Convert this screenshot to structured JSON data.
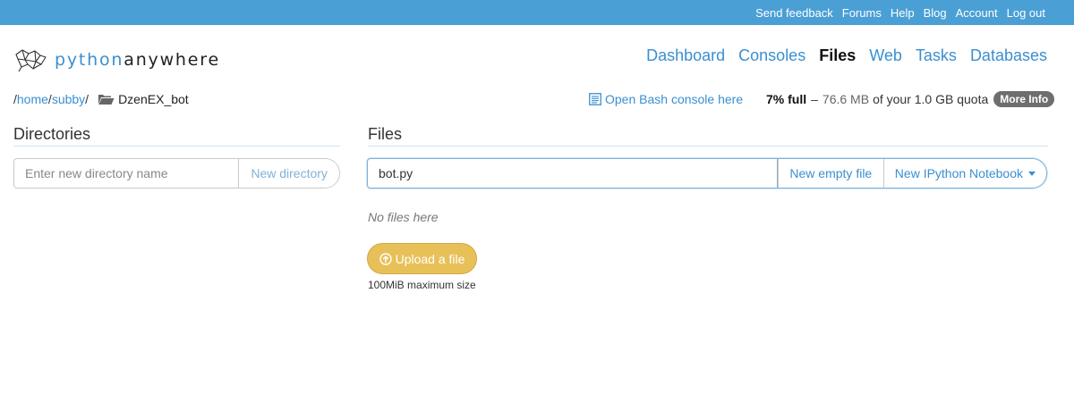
{
  "topbar": {
    "links": [
      "Send feedback",
      "Forums",
      "Help",
      "Blog",
      "Account",
      "Log out"
    ]
  },
  "logo": {
    "part1": "python",
    "part2": "anywhere",
    "icon": "python-snake-logo-icon"
  },
  "nav": {
    "items": [
      "Dashboard",
      "Consoles",
      "Files",
      "Web",
      "Tasks",
      "Databases"
    ],
    "active": "Files"
  },
  "breadcrumb": {
    "home": "home",
    "user": "subby",
    "sep": "/",
    "current": "DzenEX_bot",
    "icon": "folder-open-icon"
  },
  "bash": {
    "label": "Open Bash console here",
    "icon": "console-icon"
  },
  "quota": {
    "percent": "7% full",
    "dash": "–",
    "used": "76.6 MB",
    "rest": "of your 1.0 GB quota",
    "more": "More Info"
  },
  "directories": {
    "title": "Directories",
    "placeholder": "Enter new directory name",
    "button": "New directory"
  },
  "files": {
    "title": "Files",
    "value": "bot.py",
    "new_file": "New empty file",
    "notebook": "New IPython Notebook",
    "empty": "No files here",
    "upload": "Upload a file",
    "upload_icon": "upload-arrow-icon",
    "limit": "100MiB maximum size"
  },
  "colors": {
    "topbar": "#4a9fd5",
    "link": "#3a8fd0",
    "upload": "#e8c058",
    "badge": "#6e6e6e"
  }
}
